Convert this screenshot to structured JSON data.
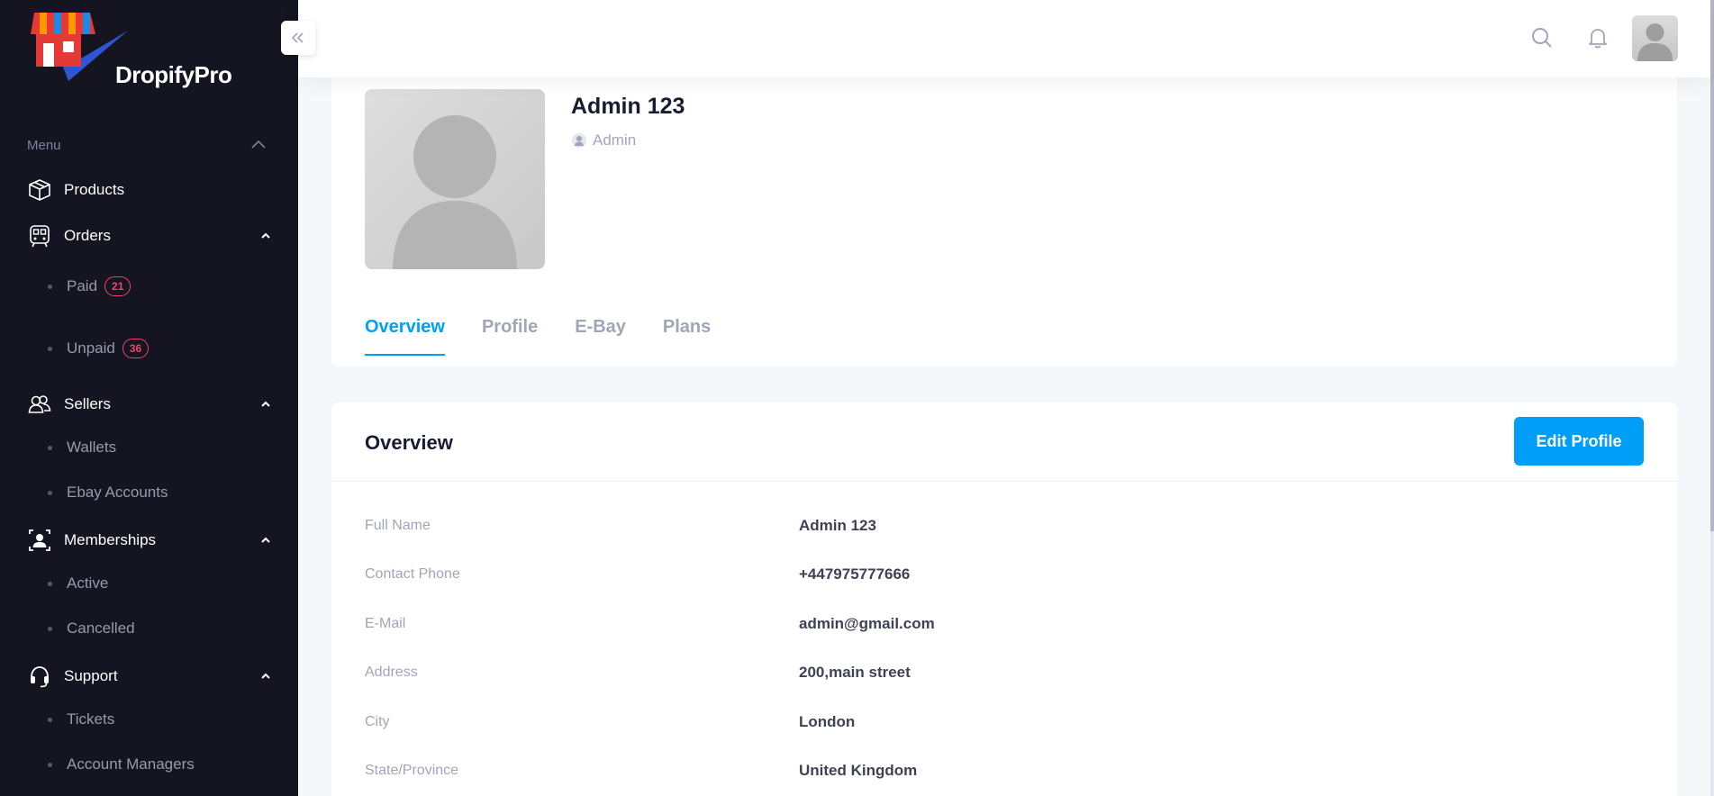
{
  "brand": {
    "name": "DropifyPro"
  },
  "sidebar": {
    "menu_heading": "Menu",
    "products": "Products",
    "orders": {
      "label": "Orders",
      "paid": "Paid",
      "paid_count": "21",
      "unpaid": "Unpaid",
      "unpaid_count": "36"
    },
    "sellers": {
      "label": "Sellers",
      "wallets": "Wallets",
      "ebay_accounts": "Ebay Accounts"
    },
    "memberships": {
      "label": "Memberships",
      "active": "Active",
      "cancelled": "Cancelled"
    },
    "support": {
      "label": "Support",
      "tickets": "Tickets",
      "account_managers": "Account Managers"
    }
  },
  "header": {
    "icons": [
      "search-icon",
      "bell-icon",
      "user-avatar"
    ]
  },
  "profile": {
    "name": "Admin 123",
    "role": "Admin",
    "tabs": [
      "Overview",
      "Profile",
      "E-Bay",
      "Plans"
    ],
    "active_tab": "Overview"
  },
  "overview": {
    "title": "Overview",
    "edit_button": "Edit Profile",
    "fields": [
      {
        "label": "Full Name",
        "value": "Admin 123"
      },
      {
        "label": "Contact Phone",
        "value": "+447975777666"
      },
      {
        "label": "E-Mail",
        "value": "admin@gmail.com"
      },
      {
        "label": "Address",
        "value": "200,main street"
      },
      {
        "label": "City",
        "value": "London"
      },
      {
        "label": "State/Province",
        "value": "United Kingdom"
      }
    ]
  },
  "colors": {
    "sidebar_bg": "#151521",
    "accent": "#009ef7",
    "badge": "#f1416c"
  }
}
